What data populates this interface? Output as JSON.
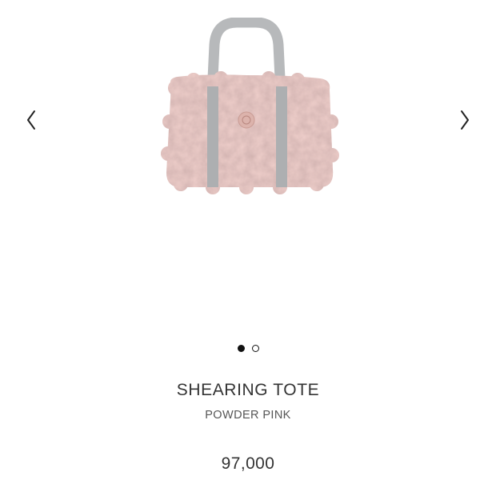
{
  "carousel": {
    "prev_icon": "chevron-left-icon",
    "next_icon": "chevron-right-icon",
    "total_slides": 2,
    "active_slide": 1
  },
  "product": {
    "name": "SHEARING TOTE",
    "color": "POWDER PINK",
    "price": "97,000",
    "colors": {
      "body": "#efcfcb",
      "handle": "#b7b9bb"
    }
  }
}
